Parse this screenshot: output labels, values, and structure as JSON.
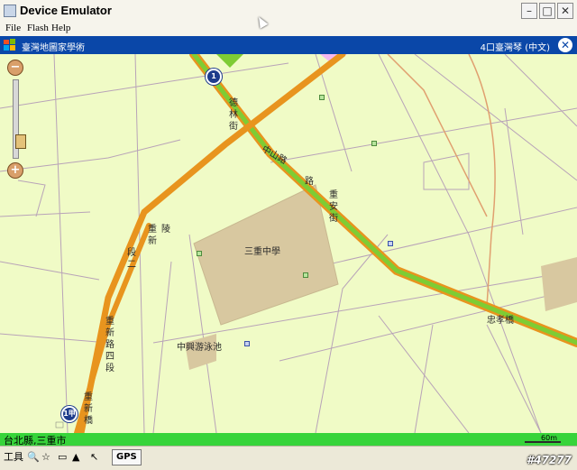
{
  "window": {
    "title": "Device Emulator"
  },
  "menu": {
    "items": [
      "File",
      "Flash",
      "Help"
    ]
  },
  "ppc": {
    "app_title": "臺灣地圖家學術",
    "status": "4口臺灣琴 (中文)",
    "close_label": "✕"
  },
  "zoom": {
    "minus": "−",
    "plus": "+"
  },
  "map": {
    "labels": {
      "school": "三重中學",
      "pool": "中興游泳池",
      "bridge_right": "忠孝橋",
      "road_zhongshan": "中山路",
      "road_side": "路",
      "road_xin": "新",
      "road_jie": "段二",
      "road_chongan": "重安街",
      "road_chongxin": "重新路四段",
      "road_bei": "重新橋",
      "road_xi": "德林街",
      "road_xi2": "重新",
      "road_lu": "陵"
    },
    "shields": [
      "1",
      "1甲"
    ],
    "colors": {
      "bg": "#f0fbc6",
      "road": "#e8941e",
      "green": "#7ecc34",
      "block": "#d8c8a0"
    }
  },
  "location": {
    "place": "台北縣,三重市",
    "scale": "60m"
  },
  "toolbar": {
    "tools_label": "工具",
    "gps_label": "GPS"
  },
  "watermark": "#47277"
}
